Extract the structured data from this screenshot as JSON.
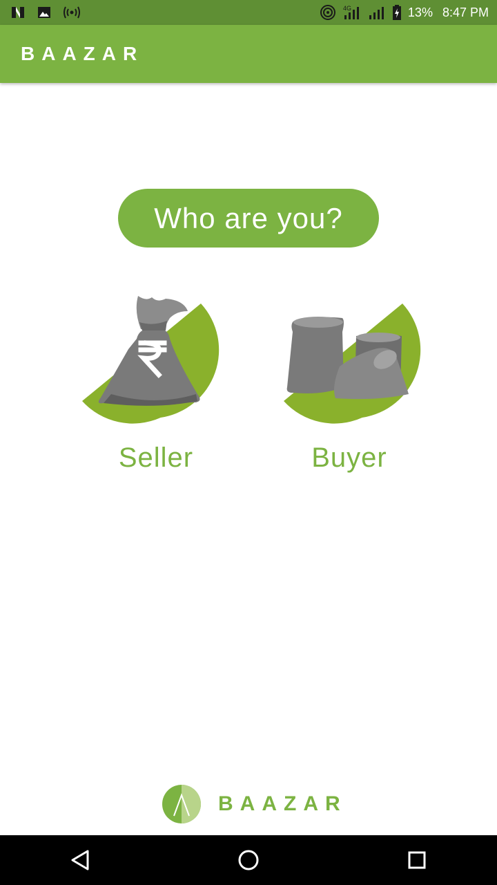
{
  "status_bar": {
    "battery": "13%",
    "time": "8:47 PM",
    "network": "4G",
    "icons": [
      "n-notification-icon",
      "image-notification-icon",
      "broadcast-icon",
      "hotspot-icon",
      "signal-icon",
      "signal-icon",
      "battery-icon"
    ]
  },
  "app_bar": {
    "title": "BAAZAR"
  },
  "prompt": {
    "text": "Who are you?"
  },
  "roles": [
    {
      "label": "Seller",
      "icon": "money-bag-icon"
    },
    {
      "label": "Buyer",
      "icon": "sacks-icon"
    }
  ],
  "footer": {
    "brand": "BAAZAR",
    "icon": "baazar-logo-icon"
  },
  "nav": {
    "icons": [
      "back-icon",
      "home-icon",
      "recents-icon"
    ]
  },
  "colors": {
    "brand_green": "#7cb342",
    "status_green": "#5f8f34",
    "circle_green": "#8ab12c",
    "bag_gray": "#757575"
  }
}
